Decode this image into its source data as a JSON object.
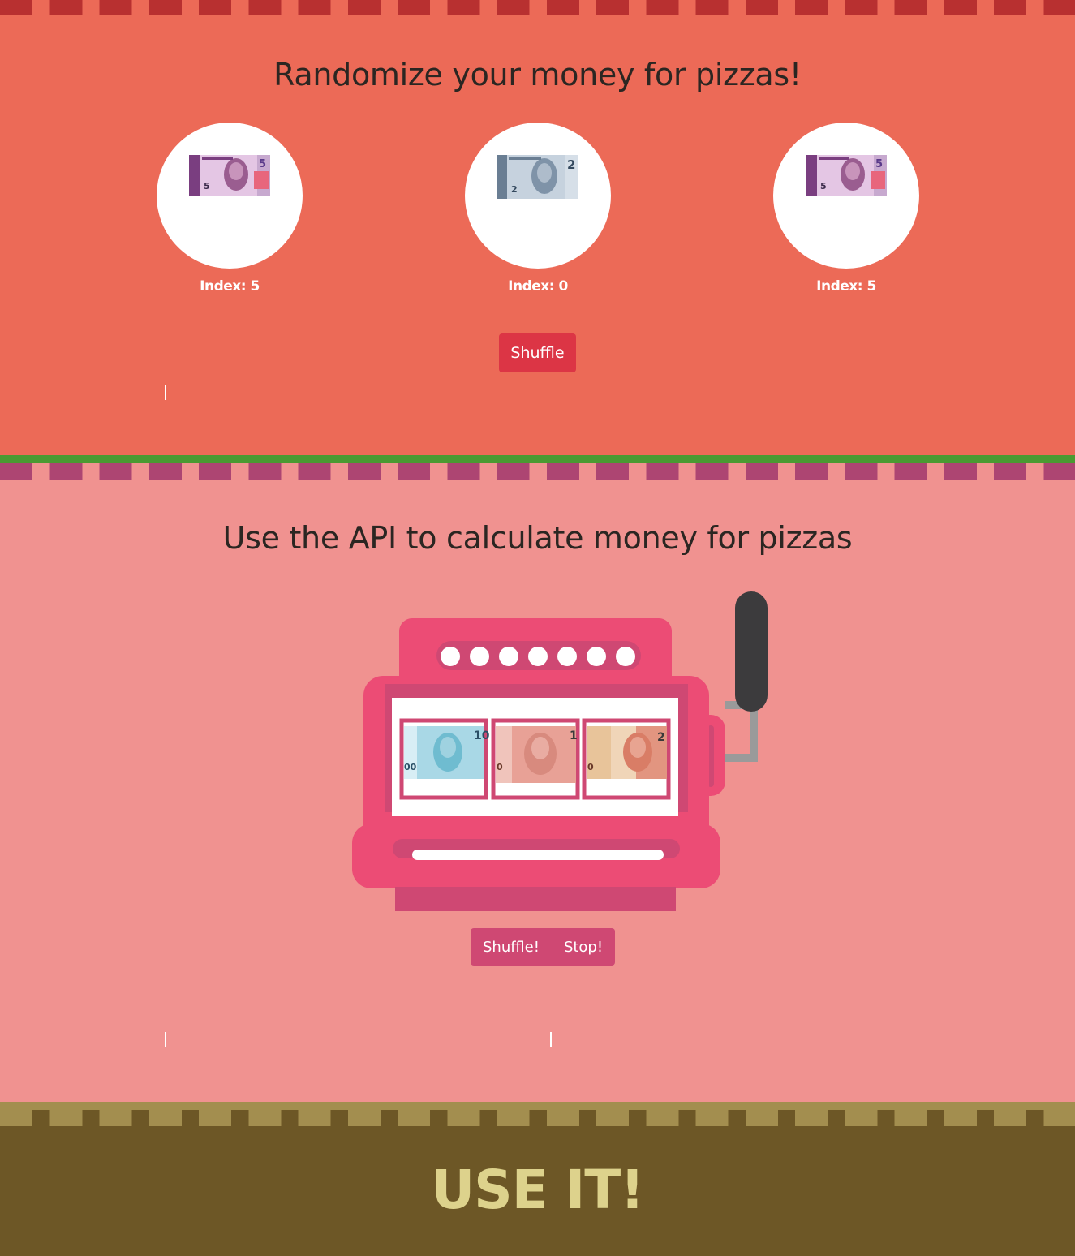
{
  "randomizer": {
    "title": "Randomize your money for pizzas!",
    "coins": [
      {
        "label": "Index: 5",
        "note": "5 reais"
      },
      {
        "label": "Index: 0",
        "note": "2 reais"
      },
      {
        "label": "Index: 5",
        "note": "5 reais"
      }
    ],
    "shuffle_label": "Shuffle"
  },
  "api": {
    "title": "Use the API to calculate money for pizzas",
    "reels": [
      "10 reais",
      "100 reais",
      "20 reais"
    ],
    "shuffle_label": "Shuffle!",
    "stop_label": "Stop!"
  },
  "footer": {
    "title": "USE IT!"
  },
  "colors": {
    "section1_bg": "#ec6a57",
    "section2_bg": "#f09290",
    "section3_bg": "#6d5726",
    "divider": "#4a9a32",
    "button_red": "#dc3545",
    "slot_pink": "#ec4c75"
  },
  "icons": [
    "banknote-5-reais",
    "banknote-2-reais",
    "banknote-10-reais",
    "banknote-100-reais",
    "banknote-20-reais",
    "slot-machine",
    "lever"
  ]
}
